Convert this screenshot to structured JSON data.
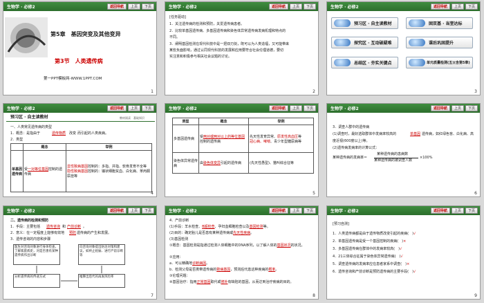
{
  "header": {
    "subject": "生物学 · 必修2",
    "nav": "返回导航",
    "prev": "上页",
    "next": "下页"
  },
  "slides": [
    {
      "page": "1",
      "chapter": "第5章　基因突变及其他变异",
      "section": "第3节　人类遗传病",
      "footer": "第一PPT模板网-WWW.1PPT.COM"
    },
    {
      "page": "2",
      "goal_title": "[任务驱动]",
      "lines": [
        "1．关注遗传病的检测和预防，关爱遗传病患者。",
        "2．比较单基因遗传病、多基因遗传病和染色体异常遗传病发病机理和特点的",
        "不同。",
        "3．阐明基因检测在现代科技中是一把双刃剑，既可以为人类造福，又可能带来",
        "某些负面影响，通过认同现代科技的发展和应用要符合社会伦理道德，要切",
        "实注意和积极参与相关社会议题的讨论。"
      ]
    },
    {
      "page": "3",
      "menu": [
        "预习区 · 自主读教材",
        "固双基 · 当堂达标",
        "探究区 · 互动破疑难",
        "课后巩固提升",
        "总结区 · 夯实关键点",
        "单元质量检测(五)(含第5章)"
      ]
    },
    {
      "page": "4",
      "title": "预习区 · 自主读教材",
      "tag": "教材阅读　基础知识",
      "lines": [
        "一、人类常见遗传病的类型",
        "1．概念：是指由于",
        "而引起的人类疾病。",
        "2．类型"
      ],
      "blank1": "遗传物质",
      "blank1_suffix": "改变",
      "table_head": [
        "",
        "概念",
        "举例"
      ],
      "row_label": "单基因遗传病",
      "row_concept": [
        "受",
        "控制的遗传病"
      ],
      "row_blank": "一对等位基因",
      "row_examples": [
        "显性致病基因",
        "控制的：多指、并指、软骨发育不全等",
        "隐性致病基因",
        "控制的：镰状细胞贫血、白化病、苯丙酮尿症等"
      ]
    },
    {
      "page": "5",
      "table_head": [
        "类型",
        "概念",
        "举例"
      ],
      "row1_label": "多基因遗传病",
      "row1_concept": [
        "受",
        "两对或两对以上的等位基因",
        "控制的遗传病"
      ],
      "row1_example": [
        "先天性发育异常、",
        "原发性高血压",
        "等",
        "冠心病、哮喘",
        "、青少年型糖尿病等"
      ],
      "row2_label": "染色体异常遗传病",
      "row2_concept": [
        "由",
        "染色体变异",
        "引起的遗传病"
      ],
      "row2_example": [
        "",
        "(先天性愚型)、猫叫综合征等"
      ]
    },
    {
      "page": "6",
      "lines": [
        "3．调查人群中的遗传病",
        "(1)调查时，最好选取群体中发病率较高的",
        "遗传病，如红绿色盲、白化病、高",
        "度近视(600度以上)等。",
        "(2)遗传病发病率的计算公式：",
        "某种遗传病的发病率＝"
      ],
      "blank": "单基因",
      "formula_top": "某种遗传病的患病数",
      "formula_bottom": "某种遗传病的被调查人数",
      "formula_suffix": "×100%"
    },
    {
      "page": "7",
      "lines": [
        "二、遗传病的检测和预防",
        "1．手段：主要包括",
        "和",
        "。",
        "2．意义：在一定程度上能够有效地",
        "遗传病的产生和发展。",
        "3．遗传咨询的内容和步骤"
      ],
      "blanks": [
        "遗传咨询",
        "产前诊断",
        "预防"
      ],
      "flow": [
        "医生对咨询对象进行身体检查，了解家庭病史，对是否患有某种遗传病作出诊断",
        "分析遗传病的传递方式",
        "推算出后代的再发风险率",
        "向咨询对象提出防治对策和建议，如终止妊娠、进行产前诊断等"
      ]
    },
    {
      "page": "8",
      "lines": [
        "4．产前诊断",
        "(1)手段：羊水检查、",
        "、孕妇血细胞检查以及",
        "等。",
        "(2)目的：确定胎儿是否患有某种遗传病或",
        "。",
        "(3)基因检测",
        "①概念：基因检测是指通过检测人体细胞中的DNA序列，以了解人体的",
        "的状况。",
        "②应用：",
        "a．可以精确地",
        "。",
        "b．检测父母是否携带遗传病的",
        "，预测后代患这种疾病的",
        "。",
        "③伦理问题：",
        "④基因治疗：指用",
        "取代或",
        "有缺陷的基因，从而达到治疗疾病的目的。"
      ],
      "blanks": [
        "B超检查",
        "基因检测",
        "先天性疾病",
        "基因状况",
        "诊断病因",
        "致病基因",
        "概率",
        "正常基因",
        "修补"
      ]
    },
    {
      "page": "9",
      "title": "[预习自测]",
      "lines": [
        "1．人类遗传病都是由于遗传物质改变引起的疾病(　)",
        "2．单基因遗传病是受一个基因控制的疾病(　)",
        "3．多基因遗传病在群体中的发病率较高(　)",
        "4．21三体综合征属于染色体异常遗传病(　)",
        "5．调查遗传病的发病率应在患者家系中调查(　)",
        "6．遗传咨询和产前诊断是预防遗传病的主要手段(　)"
      ],
      "marks": [
        "√",
        "×",
        "√",
        "√",
        "×",
        "√"
      ]
    }
  ]
}
